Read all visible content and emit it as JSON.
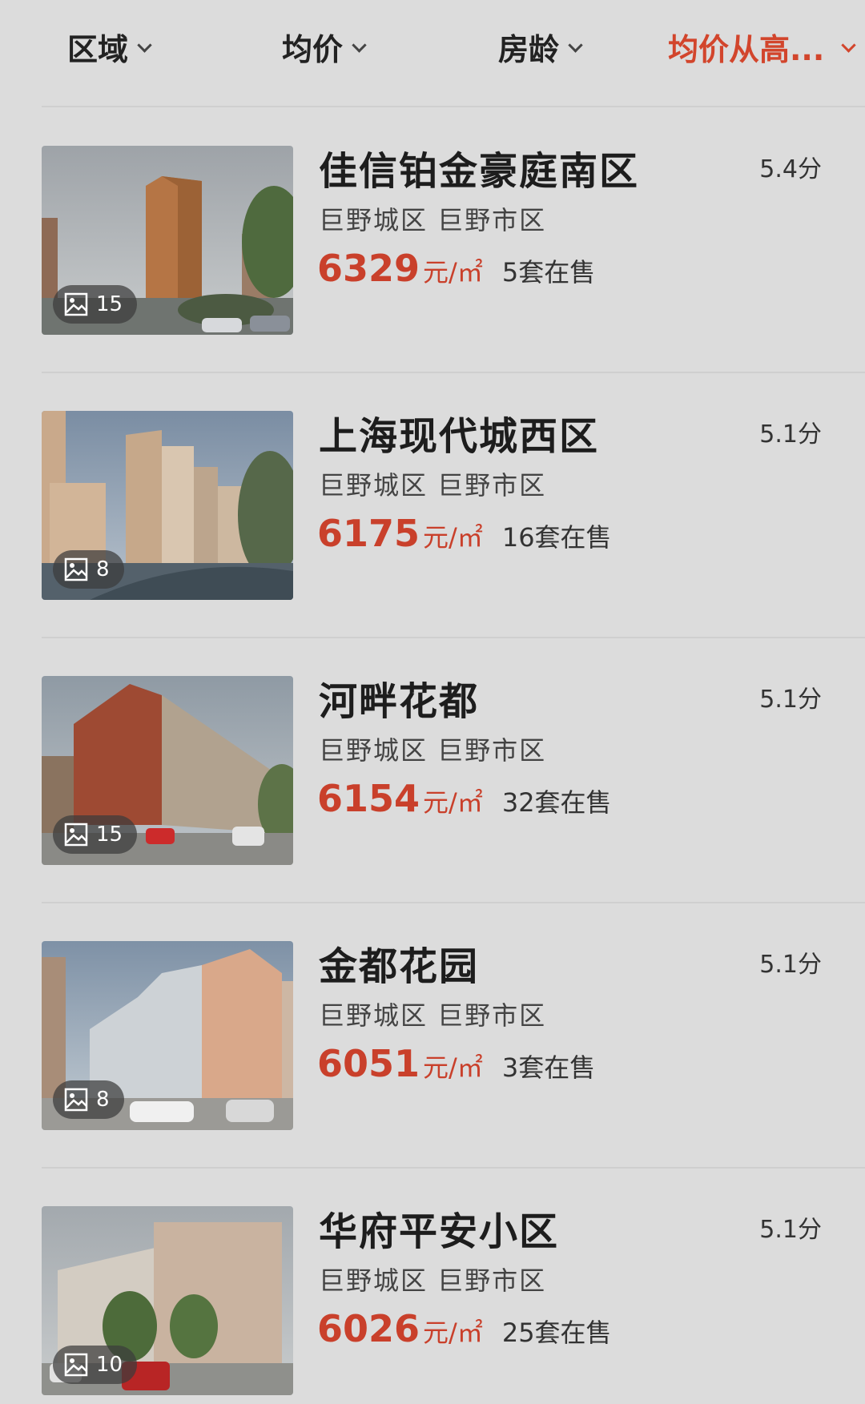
{
  "filters": [
    {
      "label": "区域",
      "active": false
    },
    {
      "label": "均价",
      "active": false
    },
    {
      "label": "房龄",
      "active": false
    },
    {
      "label": "均价从高...",
      "active": true
    }
  ],
  "listings": [
    {
      "name": "佳信铂金豪庭南区",
      "score": "5.4分",
      "district": "巨野城区 巨野市区",
      "price": "6329",
      "unit": "元/㎡",
      "on_sale": "5套在售",
      "photos": "15"
    },
    {
      "name": "上海现代城西区",
      "score": "5.1分",
      "district": "巨野城区 巨野市区",
      "price": "6175",
      "unit": "元/㎡",
      "on_sale": "16套在售",
      "photos": "8"
    },
    {
      "name": "河畔花都",
      "score": "5.1分",
      "district": "巨野城区 巨野市区",
      "price": "6154",
      "unit": "元/㎡",
      "on_sale": "32套在售",
      "photos": "15"
    },
    {
      "name": "金都花园",
      "score": "5.1分",
      "district": "巨野城区 巨野市区",
      "price": "6051",
      "unit": "元/㎡",
      "on_sale": "3套在售",
      "photos": "8"
    },
    {
      "name": "华府平安小区",
      "score": "5.1分",
      "district": "巨野城区 巨野市区",
      "price": "6026",
      "unit": "元/㎡",
      "on_sale": "25套在售",
      "photos": "10"
    }
  ],
  "colors": {
    "accent": "#c9402b",
    "background": "#dcdcdc"
  }
}
